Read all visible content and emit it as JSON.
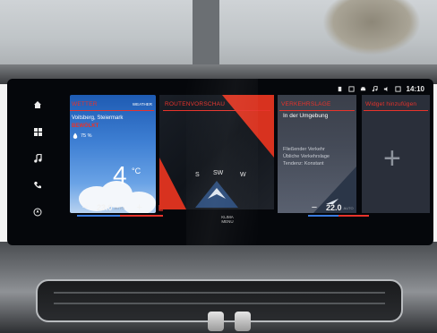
{
  "status_bar": {
    "icons": [
      "battery-icon",
      "phone-icon",
      "car-icon",
      "music-icon",
      "volume-icon",
      "message-icon"
    ],
    "time": "14:10"
  },
  "sidebar": {
    "items": [
      {
        "name": "home",
        "glyph": "⌂"
      },
      {
        "name": "apps",
        "glyph": "▦"
      },
      {
        "name": "media",
        "glyph": "♫"
      },
      {
        "name": "phone",
        "glyph": "✆"
      },
      {
        "name": "navigation",
        "glyph": "◈"
      }
    ]
  },
  "weather": {
    "title": "WETTER",
    "link": "WEATHER",
    "location": "Voitsberg, Steiermark",
    "condition": "BEWÖLKT",
    "humidity": "75 %",
    "temperature": "4",
    "unit": "°C"
  },
  "climate_left": {
    "minus": "−",
    "value": "23.0",
    "mode": "AUTO",
    "plus": "+"
  },
  "route": {
    "title": "ROUTENVORSCHAU",
    "compass": [
      "S",
      "SW",
      "W"
    ],
    "climate_label": "KLIMA MENU"
  },
  "traffic": {
    "title": "VERKEHRSLAGE",
    "subtitle": "In der Umgebung",
    "lines": [
      "Fließender Verkehr",
      "Übliche Verkehrslage",
      "Tendenz: Konstant"
    ]
  },
  "climate_right": {
    "minus": "−",
    "value": "22.0",
    "mode": "AUTO",
    "plus": "+"
  },
  "widget": {
    "title": "Widget hinzufügen",
    "add": "+"
  },
  "colors": {
    "accent": "#e8332b",
    "screen_bg": "#05070b",
    "climate_blue": "#3a7be0",
    "climate_red": "#e8332b"
  }
}
